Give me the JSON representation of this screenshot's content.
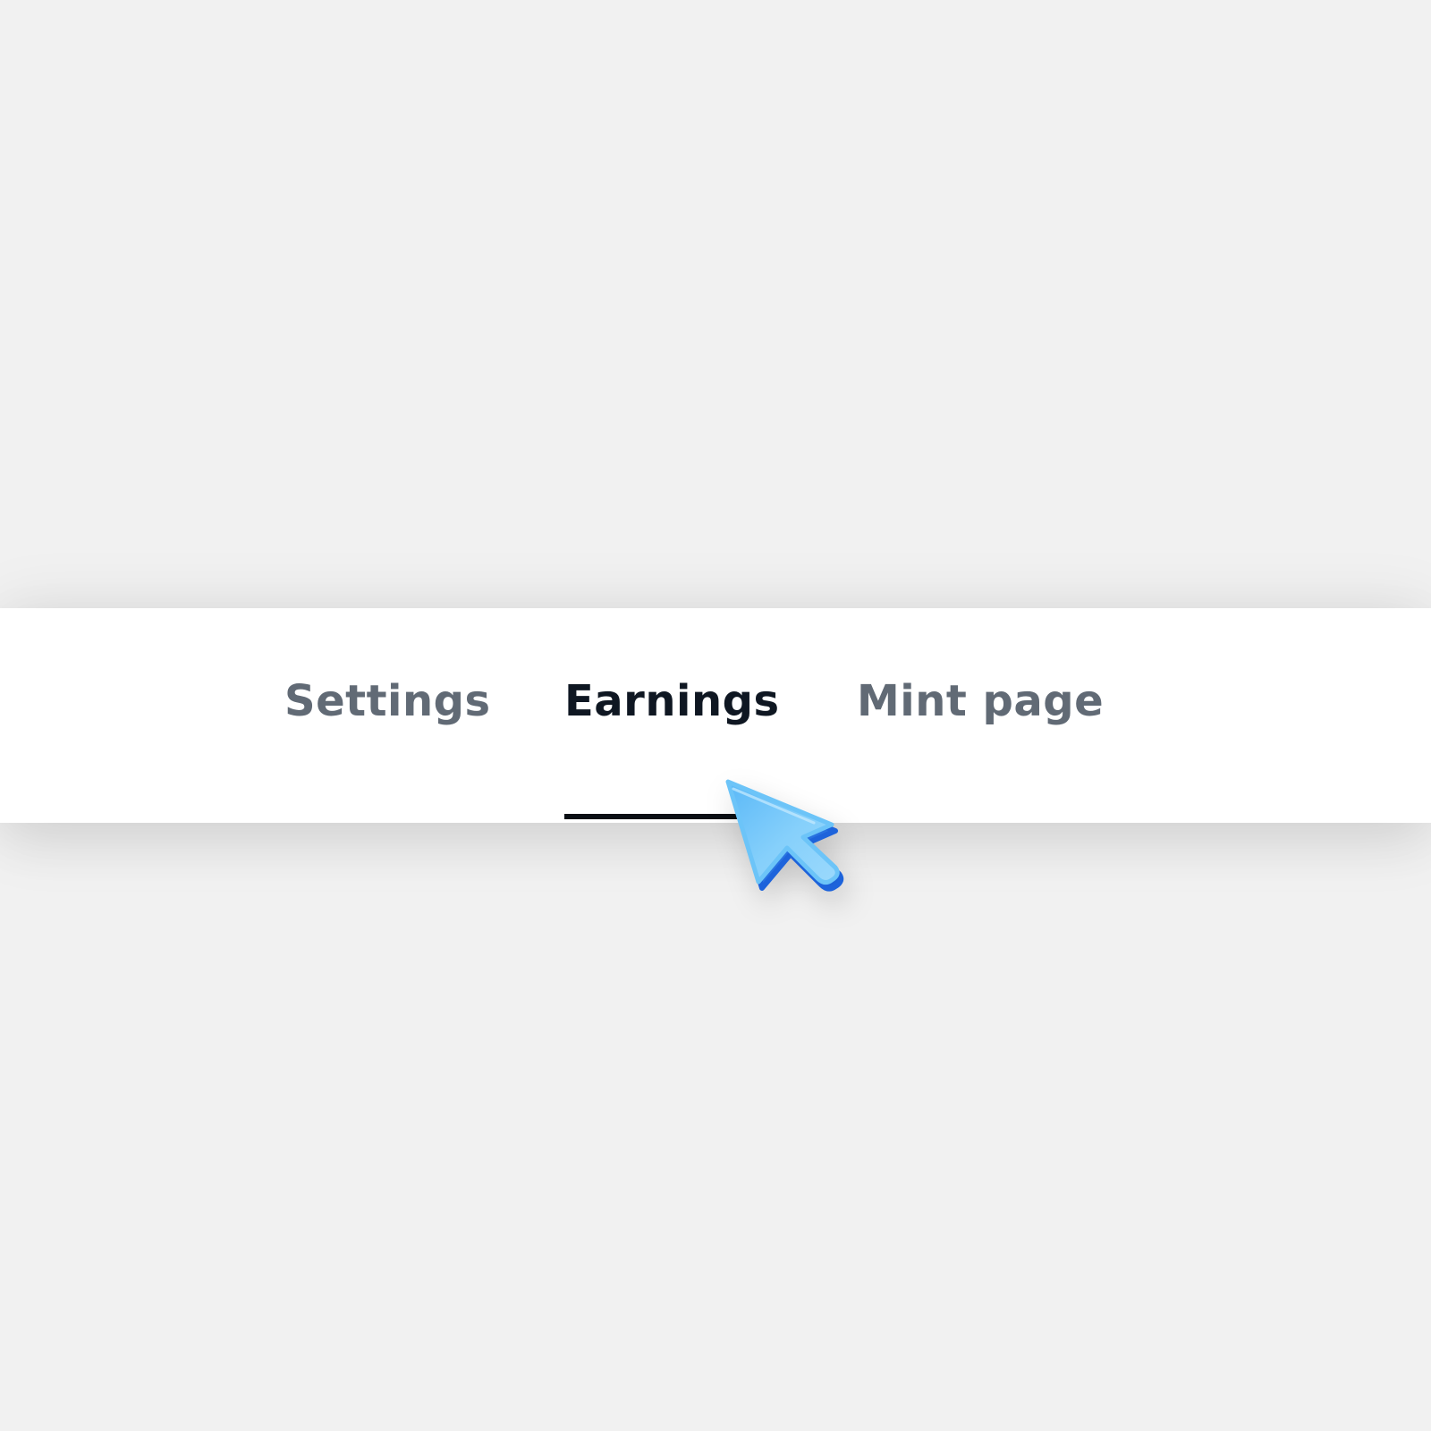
{
  "tabs": {
    "items": [
      {
        "label": "Settings",
        "active": false
      },
      {
        "label": "Earnings",
        "active": true
      },
      {
        "label": "Mint page",
        "active": false
      }
    ]
  },
  "colors": {
    "background": "#f1f1f1",
    "tab_bar_background": "#ffffff",
    "active_text": "#0f1722",
    "inactive_text": "#616a75",
    "active_indicator": "#0a0e14",
    "cursor_light": "#8fd3fb",
    "cursor_mid": "#58b7f6",
    "cursor_dark": "#1f6fe0"
  },
  "cursor": {
    "icon": "pointer-arrow-icon"
  }
}
